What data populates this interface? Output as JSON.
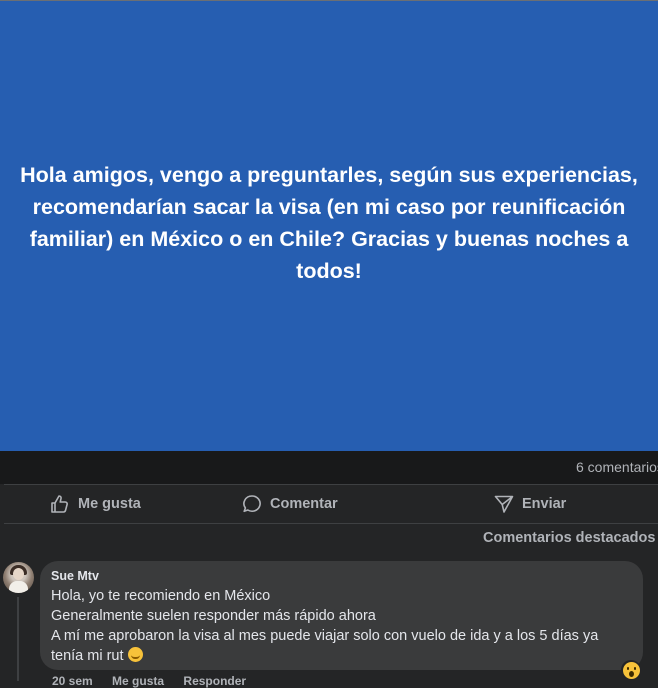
{
  "post": {
    "text": "Hola amigos, vengo a preguntarles, según sus experiencias, recomendarían sacar la visa (en mi caso por reunificación familiar) en México o en Chile? Gracias y buenas noches a todos!",
    "background_color": "#265eb1"
  },
  "stats": {
    "comments_count": "6 comentarios"
  },
  "actions": {
    "like_label": "Me gusta",
    "comment_label": "Comentar",
    "send_label": "Enviar",
    "like_icon": "thumbs-up-icon",
    "comment_icon": "speech-bubble-icon",
    "send_icon": "send-icon"
  },
  "comments_section": {
    "sort_label": "Comentarios destacados"
  },
  "comment": {
    "author": "Sue Mtv",
    "lines": [
      "Hola, yo te recomiendo en México",
      "Generalmente suelen responder más rápido ahora",
      "A mí me aprobaron la visa al mes puede viajar solo con vuelo de ida y a los 5 días ya",
      "tenía mi rut"
    ],
    "emoji": "smiling-face-icon",
    "reaction": "wow-reaction-icon",
    "time": "20 sem",
    "like_label": "Me gusta",
    "reply_label": "Responder"
  }
}
